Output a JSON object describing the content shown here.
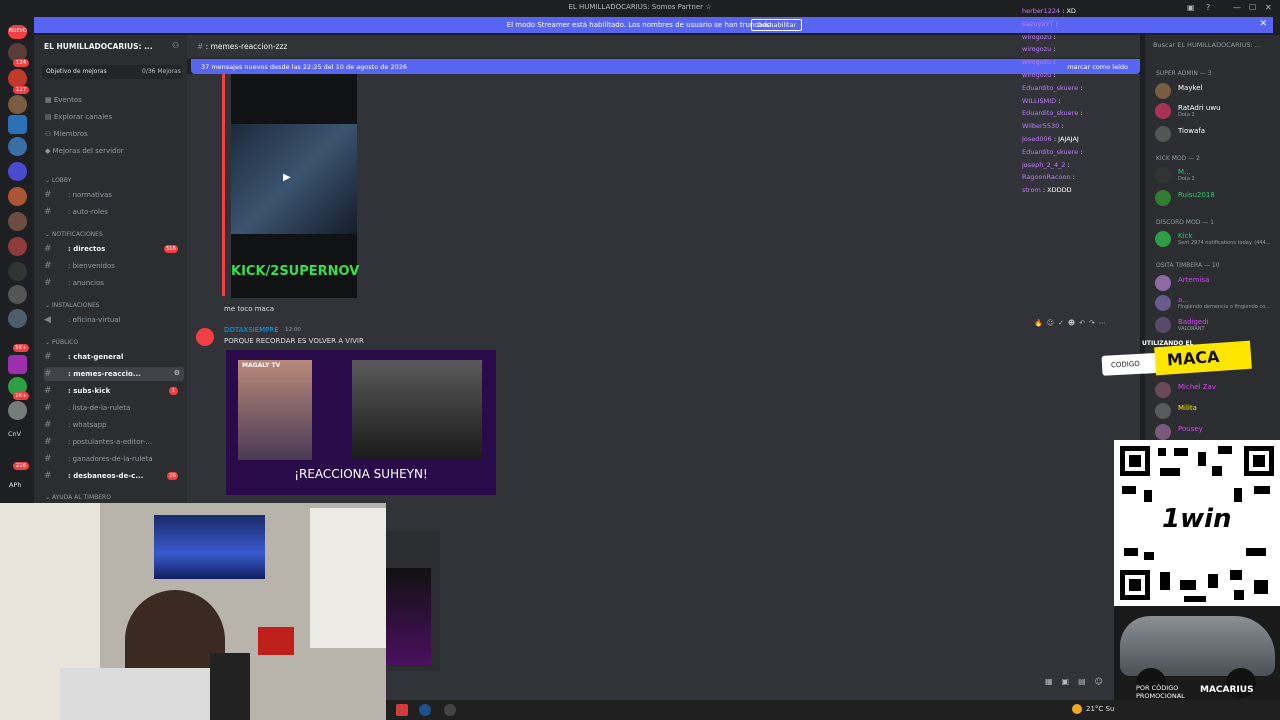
{
  "window": {
    "title": "EL HUMILLADOCARIUS: Somos Partner ☆",
    "controls": [
      "▣",
      "?",
      "—",
      "☐",
      "✕"
    ]
  },
  "streamer_bar": {
    "message": "El modo Streamer está habilitado. Los nombres de usuario se han truncado.",
    "button": "Deshabilitar",
    "close": "✕"
  },
  "server_rail": {
    "badges": [
      {
        "label": "NUEVO"
      },
      {
        "label": "124"
      },
      {
        "label": "127"
      },
      {
        "label": "5K+"
      },
      {
        "label": "2K+"
      },
      {
        "label": "226"
      }
    ],
    "bottom_labels": [
      "CnV",
      "APh"
    ]
  },
  "server": {
    "name": "EL HUMILLADOCARIUS: ...",
    "goal_label": "Objetivo de mejoras",
    "goal_value": "0/36 Mejoras",
    "nav": [
      "Eventos",
      "Explorar canales",
      "Miembros",
      "Mejoras del servidor"
    ]
  },
  "categories": {
    "lobby": "LOBBY",
    "notificaciones": "NOTIFICACIONES",
    "instalaciones": "INSTALACIONES",
    "publico": "PÚBLICO",
    "ayuda": "AYUDA AL TIMBERO"
  },
  "channels": {
    "normativas": {
      "label": ": normativas"
    },
    "auto_roles": {
      "label": ": auto-roles"
    },
    "directos": {
      "label": ": directos",
      "badge": "316"
    },
    "bienvenidos": {
      "label": ": bienvenidos"
    },
    "anuncios": {
      "label": ": anuncios"
    },
    "oficina": {
      "label": ": oficina-virtual"
    },
    "chat_general": {
      "label": ": chat-general"
    },
    "memes": {
      "label": ": memes-reaccio..."
    },
    "subs_kick": {
      "label": ": subs-kick",
      "badge": "1"
    },
    "ruleta": {
      "label": ": lista-de-la-ruleta"
    },
    "whatsapp": {
      "label": ": whatsapp"
    },
    "postulantes": {
      "label": ": postulantes-a-editor-..."
    },
    "ganadores": {
      "label": ": ganadores-de-la-ruleta"
    },
    "desbaneos": {
      "label": ": desbaneos-de-c...",
      "badge": "26"
    }
  },
  "header": {
    "channel": ": memes-reaccion-zzz",
    "search_placeholder": "Buscar EL HUMILLADOCARIUS: ..."
  },
  "new_messages": {
    "text": "37 mensajes nuevos desde las 22:25 del 10 de agosto de 2026",
    "mark_read": "marcar como leído"
  },
  "messages": {
    "first": {
      "embed_caption": "KICK/2SUPERNOV",
      "text": "me toco maca"
    },
    "second": {
      "author": "DOTAXSIEMPRE",
      "time": "12:00",
      "text": "PORQUE RECORDAR ES VOLVER A VIVIR",
      "embed_caption": "¡REACCIONA SUHEYN!",
      "embed_brand": "MAGALY TV"
    }
  },
  "overlay_chat": [
    {
      "user": "herber1224",
      "msg": ": XD"
    },
    {
      "user": "KazuyaYT",
      "msg": ":"
    },
    {
      "user": "wirogozu",
      "msg": ":"
    },
    {
      "user": "wirogozu",
      "msg": ":"
    },
    {
      "user": "wirogozu",
      "msg": ":"
    },
    {
      "user": "wirogozu",
      "msg": ":"
    },
    {
      "user": "Eduardito_skuere",
      "msg": ":"
    },
    {
      "user": "WILLISMID",
      "msg": ":"
    },
    {
      "user": "Eduardito_skuere",
      "msg": ":"
    },
    {
      "user": "Wilber5530",
      "msg": ":"
    },
    {
      "user": "Josed006",
      "msg": ": JAJAJAJ"
    },
    {
      "user": "Eduardito_skuere",
      "msg": ":"
    },
    {
      "user": "joseph_2_4_2",
      "msg": ":"
    },
    {
      "user": "RagoonRacoon",
      "msg": ":"
    },
    {
      "user": "strom",
      "msg": ": XDDDD"
    }
  ],
  "members": {
    "roles": {
      "super_admin": "SUPER ADMIN — 3",
      "kick_mod": "KICK MOD — 2",
      "discord_mod": "DISCORD MOD — 1",
      "osita": "OSITA TIMBERA — 10"
    },
    "super_admin": [
      {
        "name": "Maykel",
        "tag": "LATM",
        "status": ""
      },
      {
        "name": "RatAdri uwu",
        "tag": "MT",
        "status": "Dota 2"
      },
      {
        "name": "Tiowafa",
        "tag": "",
        "status": ""
      }
    ],
    "kick_mod": [
      {
        "name": "M...",
        "tag": "FEKA",
        "status": "Dota 2"
      },
      {
        "name": "Ruisu2018",
        "tag": "",
        "status": ""
      }
    ],
    "discord_mod": [
      {
        "name": "Kick",
        "tag": "APP",
        "status": "Sent 2974 notifications today. (444..."
      }
    ],
    "osita": [
      {
        "name": "Artemisa",
        "tag": "",
        "status": ""
      },
      {
        "name": "a...",
        "tag": "OHÑO",
        "status": "Fingiendo demencia o fingiendo co..."
      },
      {
        "name": "Badigedi",
        "tag": "",
        "status": "VALORANT"
      },
      {
        "name": "Michel Zav",
        "tag": "OHÑO",
        "status": ""
      },
      {
        "name": "Milita",
        "tag": "",
        "status": ""
      },
      {
        "name": "Pousey",
        "tag": "",
        "status": ""
      }
    ]
  },
  "promo": {
    "pre": "UTILIZANDO EL",
    "code_label": "CODIGO",
    "code": "MACA",
    "brand": "1win",
    "footer_left": "POR CÓDIGO PROMOCIONAL",
    "footer_right": "MACARIUS"
  },
  "taskbar": {
    "weather": "21°C Su"
  },
  "colors": {
    "accent": "#5865f2",
    "badge": "#f23f43",
    "promo_yellow": "#ffe600"
  }
}
